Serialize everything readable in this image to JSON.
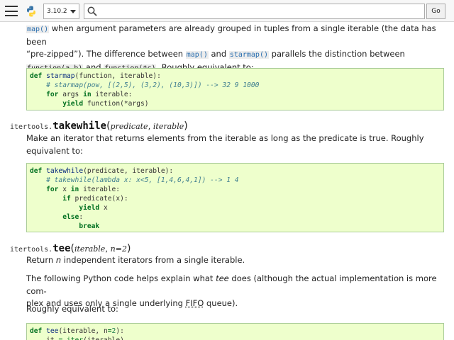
{
  "topbar": {
    "version": "3.10.2",
    "search_placeholder": "",
    "go_label": "Go"
  },
  "content": {
    "intro_line1_a": "",
    "intro_map": "map()",
    "intro_line1_b": " when argument parameters are already grouped in tuples from a single iterable (the data has been",
    "intro_line2": "“pre-zipped”). The difference between ",
    "intro_map2": "map()",
    "intro_and": " and ",
    "intro_starmap": "starmap()",
    "intro_line2_b": " parallels the distinction between",
    "intro_func1": "function(a,b)",
    "intro_and2": " and ",
    "intro_func2": "function(*c)",
    "intro_tail": ". Roughly equivalent to:",
    "starmap_code": [
      [
        [
          "kw",
          "def "
        ],
        [
          "fn",
          "starmap"
        ],
        [
          "tx",
          "(function, iterable):"
        ]
      ],
      [
        [
          "tx",
          "    "
        ],
        [
          "cm",
          "# starmap(pow, [(2,5), (3,2), (10,3)]) --> 32 9 1000"
        ]
      ],
      [
        [
          "tx",
          "    "
        ],
        [
          "kw",
          "for"
        ],
        [
          "tx",
          " args "
        ],
        [
          "op",
          "in"
        ],
        [
          "tx",
          " iterable:"
        ]
      ],
      [
        [
          "tx",
          "        "
        ],
        [
          "kw",
          "yield"
        ],
        [
          "tx",
          " function(*args)"
        ]
      ]
    ],
    "takewhile_mod": "itertools.",
    "takewhile_name": "takewhile",
    "takewhile_args": [
      {
        "name": "predicate",
        "sep": ", "
      },
      {
        "name": "iterable",
        "sep": ""
      }
    ],
    "takewhile_desc": "Make an iterator that returns elements from the iterable as long as the predicate is true. Roughly equivalent to:",
    "takewhile_code": [
      [
        [
          "kw",
          "def "
        ],
        [
          "fn",
          "takewhile"
        ],
        [
          "tx",
          "(predicate, iterable):"
        ]
      ],
      [
        [
          "tx",
          "    "
        ],
        [
          "cm",
          "# takewhile(lambda x: x<5, [1,4,6,4,1]) --> 1 4"
        ]
      ],
      [
        [
          "tx",
          "    "
        ],
        [
          "kw",
          "for"
        ],
        [
          "tx",
          " x "
        ],
        [
          "op",
          "in"
        ],
        [
          "tx",
          " iterable:"
        ]
      ],
      [
        [
          "tx",
          "        "
        ],
        [
          "kw",
          "if"
        ],
        [
          "tx",
          " predicate(x):"
        ]
      ],
      [
        [
          "tx",
          "            "
        ],
        [
          "kw",
          "yield"
        ],
        [
          "tx",
          " x"
        ]
      ],
      [
        [
          "tx",
          "        "
        ],
        [
          "kw",
          "else"
        ],
        [
          "tx",
          ":"
        ]
      ],
      [
        [
          "tx",
          "            "
        ],
        [
          "kw",
          "break"
        ]
      ]
    ],
    "tee_mod": "itertools.",
    "tee_name": "tee",
    "tee_args": [
      {
        "name": "iterable",
        "sep": ", "
      },
      {
        "name": "n=2",
        "sep": ""
      }
    ],
    "tee_desc_a": "Return ",
    "tee_desc_n": "n",
    "tee_desc_b": " independent iterators from a single iterable.",
    "tee_expl_a": "The following Python code helps explain what ",
    "tee_expl_tee": "tee",
    "tee_expl_b": " does (although the actual implementation is more com-",
    "tee_expl_c": "plex and uses only a single underlying ",
    "tee_expl_fifo": "FIFO",
    "tee_expl_d": " queue).",
    "tee_rough": "Roughly equivalent to:",
    "tee_code": [
      [
        [
          "kw",
          "def "
        ],
        [
          "fn",
          "tee"
        ],
        [
          "tx",
          "(iterable, n"
        ],
        [
          "op",
          "="
        ],
        [
          "num",
          "2"
        ],
        [
          "tx",
          "):"
        ]
      ],
      [
        [
          "tx",
          "    it "
        ],
        [
          "op",
          "="
        ],
        [
          "tx",
          " "
        ],
        [
          "bi",
          "iter"
        ],
        [
          "tx",
          "(iterable)"
        ]
      ]
    ]
  }
}
